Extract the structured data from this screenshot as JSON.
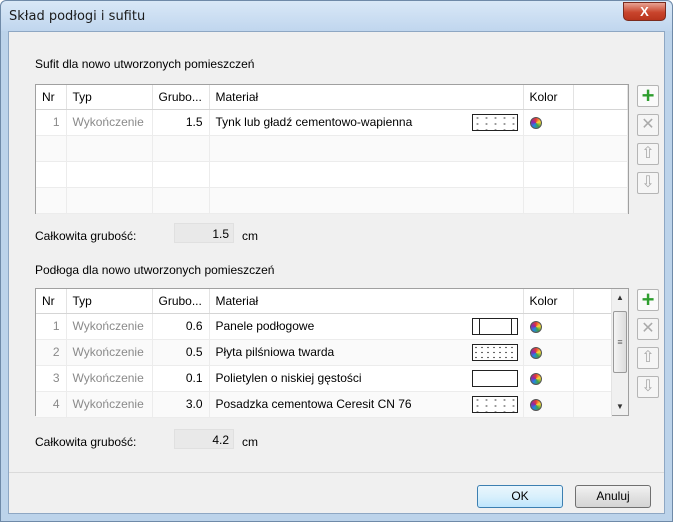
{
  "window": {
    "title": "Skład podłogi i sufitu",
    "close_label": "X"
  },
  "ceiling": {
    "section_label": "Sufit dla nowo utworzonych pomieszczeń",
    "columns": [
      "Nr",
      "Typ",
      "Grubo...",
      "Materiał",
      "Kolor"
    ],
    "rows": [
      {
        "nr": "1",
        "typ": "Wykończenie",
        "thickness": "1.5",
        "material": "Tynk lub gładź cementowo-wapienna",
        "pattern": "dots"
      }
    ],
    "total_label": "Całkowita grubość:",
    "total_value": "1.5",
    "unit": "cm"
  },
  "floor": {
    "section_label": "Podłoga dla nowo utworzonych pomieszczeń",
    "columns": [
      "Nr",
      "Typ",
      "Grubo...",
      "Materiał",
      "Kolor"
    ],
    "rows": [
      {
        "nr": "1",
        "typ": "Wykończenie",
        "thickness": "0.6",
        "material": "Panele podłogowe",
        "pattern": "panel"
      },
      {
        "nr": "2",
        "typ": "Wykończenie",
        "thickness": "0.5",
        "material": "Płyta pilśniowa twarda",
        "pattern": "fibre"
      },
      {
        "nr": "3",
        "typ": "Wykończenie",
        "thickness": "0.1",
        "material": "Polietylen o niskiej gęstości",
        "pattern": "none"
      },
      {
        "nr": "4",
        "typ": "Wykończenie",
        "thickness": "3.0",
        "material": "Posadzka cementowa Ceresit CN 76",
        "pattern": "dots"
      }
    ],
    "total_label": "Całkowita grubość:",
    "total_value": "4.2",
    "unit": "cm"
  },
  "side_buttons": {
    "add_icon": "plus-icon",
    "delete_icon": "x-icon",
    "up_icon": "arrow-up-icon",
    "down_icon": "arrow-down-icon"
  },
  "buttons": {
    "ok": "OK",
    "cancel": "Anuluj"
  },
  "colors": {
    "accent_green": "#2e9e2e",
    "titlebar": "#c0d6ee",
    "close": "#c9452d"
  }
}
